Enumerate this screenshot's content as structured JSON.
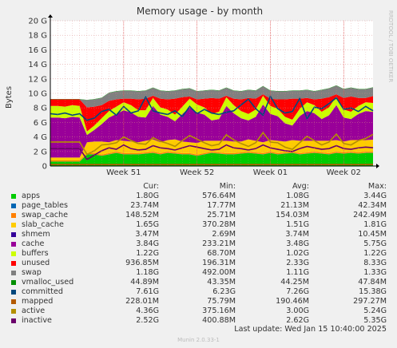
{
  "chart_data": {
    "type": "area",
    "title": "Memory usage - by month",
    "ylabel": "Bytes",
    "watermark": "RRDTOOL / TOBI OETIKER",
    "ylim": [
      0,
      20
    ],
    "yticks": [
      0,
      2,
      4,
      6,
      8,
      10,
      12,
      14,
      16,
      18,
      20
    ],
    "ytick_labels": [
      "0",
      "2 G",
      "4 G",
      "6 G",
      "8 G",
      "10 G",
      "12 G",
      "14 G",
      "16 G",
      "18 G",
      "20 G"
    ],
    "ytick_unit": "G",
    "xlim": [
      0,
      44
    ],
    "xticks": [
      {
        "label": "Week 51",
        "x": 10
      },
      {
        "label": "Week 52",
        "x": 20
      },
      {
        "label": "Week 01",
        "x": 30
      },
      {
        "label": "Week 02",
        "x": 40
      }
    ],
    "x_unit": "days",
    "stacked": true,
    "series": [
      {
        "name": "apps",
        "color": "#00cc00",
        "values": [
          0.6,
          0.6,
          0.6,
          0.6,
          0.6,
          1.6,
          1.6,
          1.4,
          1.6,
          1.8,
          1.6,
          1.6,
          1.6,
          1.7,
          1.8,
          1.6,
          1.8,
          1.7,
          1.6,
          1.6,
          1.4,
          1.6,
          1.8,
          1.7,
          1.6,
          1.6,
          1.7,
          1.8,
          1.7,
          1.6,
          1.8,
          1.6,
          1.7,
          1.8,
          1.6,
          1.7,
          1.8,
          1.7,
          1.6,
          1.8,
          1.7,
          1.8,
          1.7,
          1.8,
          1.8
        ]
      },
      {
        "name": "page_tables",
        "color": "#0066b3",
        "values": [
          0.02,
          0.02,
          0.02,
          0.02,
          0.02,
          0.02,
          0.02,
          0.02,
          0.02,
          0.02,
          0.02,
          0.02,
          0.02,
          0.02,
          0.02,
          0.02,
          0.02,
          0.02,
          0.02,
          0.02,
          0.02,
          0.02,
          0.02,
          0.02,
          0.02,
          0.02,
          0.02,
          0.02,
          0.02,
          0.02,
          0.02,
          0.02,
          0.02,
          0.02,
          0.02,
          0.02,
          0.02,
          0.02,
          0.02,
          0.02,
          0.02,
          0.02,
          0.02,
          0.02,
          0.02
        ]
      },
      {
        "name": "swap_cache",
        "color": "#ff8000",
        "values": [
          0.15,
          0.15,
          0.15,
          0.15,
          0.15,
          0.15,
          0.15,
          0.15,
          0.15,
          0.15,
          0.15,
          0.15,
          0.15,
          0.15,
          0.15,
          0.15,
          0.15,
          0.15,
          0.15,
          0.15,
          0.15,
          0.15,
          0.15,
          0.15,
          0.15,
          0.15,
          0.15,
          0.15,
          0.15,
          0.15,
          0.15,
          0.15,
          0.15,
          0.15,
          0.15,
          0.15,
          0.15,
          0.15,
          0.15,
          0.15,
          0.15,
          0.15,
          0.15,
          0.15,
          0.15
        ]
      },
      {
        "name": "slab_cache",
        "color": "#ffcc00",
        "values": [
          0.4,
          0.4,
          0.4,
          0.4,
          0.4,
          1.5,
          1.6,
          1.8,
          1.5,
          1.6,
          1.7,
          1.6,
          1.5,
          1.6,
          1.7,
          1.5,
          1.6,
          1.8,
          1.6,
          1.5,
          1.6,
          1.7,
          1.5,
          1.6,
          1.7,
          1.6,
          1.5,
          1.7,
          1.6,
          1.5,
          1.6,
          1.7,
          1.5,
          1.6,
          1.7,
          1.6,
          1.5,
          1.6,
          1.7,
          1.6,
          1.5,
          1.6,
          1.7,
          1.6,
          1.65
        ]
      },
      {
        "name": "shmem",
        "color": "#330099",
        "values": [
          0.003,
          0.003,
          0.003,
          0.003,
          0.003,
          0.003,
          0.003,
          0.003,
          0.003,
          0.003,
          0.003,
          0.003,
          0.003,
          0.003,
          0.003,
          0.003,
          0.003,
          0.003,
          0.003,
          0.003,
          0.003,
          0.003,
          0.003,
          0.003,
          0.003,
          0.003,
          0.003,
          0.003,
          0.003,
          0.003,
          0.003,
          0.003,
          0.003,
          0.003,
          0.003,
          0.003,
          0.003,
          0.003,
          0.003,
          0.003,
          0.003,
          0.003,
          0.003,
          0.003,
          0.003
        ]
      },
      {
        "name": "cache",
        "color": "#990099",
        "values": [
          5.5,
          5.5,
          5.4,
          5.6,
          5.5,
          1.0,
          1.6,
          2.4,
          3.4,
          3.6,
          4.2,
          4.0,
          3.5,
          3.2,
          4.6,
          3.8,
          3.2,
          2.5,
          3.8,
          4.8,
          4.2,
          3.6,
          2.8,
          3.0,
          4.8,
          3.9,
          3.2,
          2.6,
          3.3,
          5.2,
          3.6,
          3.4,
          2.5,
          2.0,
          3.4,
          4.1,
          3.8,
          3.0,
          3.5,
          4.8,
          3.3,
          2.9,
          3.6,
          4.0,
          3.84
        ]
      },
      {
        "name": "buffers",
        "color": "#ccff00",
        "values": [
          1.6,
          1.6,
          1.6,
          1.6,
          1.6,
          0.5,
          0.6,
          0.8,
          0.9,
          1.0,
          1.1,
          1.0,
          0.9,
          1.0,
          1.1,
          1.0,
          1.0,
          0.9,
          1.0,
          1.2,
          1.1,
          1.0,
          0.9,
          1.0,
          1.2,
          1.1,
          1.0,
          0.9,
          1.0,
          1.2,
          1.1,
          1.0,
          0.9,
          0.8,
          1.0,
          1.2,
          1.1,
          1.0,
          1.1,
          1.2,
          1.1,
          1.0,
          1.1,
          1.2,
          1.22
        ]
      },
      {
        "name": "unused",
        "color": "#ff0000",
        "values": [
          0.9,
          0.9,
          1.0,
          0.8,
          0.9,
          3.3,
          2.6,
          1.8,
          1.4,
          1.0,
          0.5,
          0.9,
          1.5,
          1.6,
          0.3,
          1.2,
          1.4,
          2.2,
          1.3,
          0.3,
          0.7,
          1.2,
          2.2,
          1.8,
          0.2,
          0.9,
          1.6,
          2.2,
          1.5,
          0.2,
          1.0,
          1.3,
          2.4,
          2.9,
          1.4,
          0.6,
          0.8,
          1.8,
          1.4,
          0.3,
          1.6,
          2.1,
          1.1,
          0.6,
          0.94
        ]
      },
      {
        "name": "swap",
        "color": "#808080",
        "values": [
          0.0,
          0.0,
          0.0,
          0.0,
          0.0,
          1.0,
          1.0,
          1.0,
          1.1,
          1.1,
          1.1,
          1.1,
          1.1,
          1.1,
          1.1,
          1.1,
          1.1,
          1.1,
          1.1,
          1.1,
          1.1,
          1.1,
          1.1,
          1.1,
          1.1,
          1.1,
          1.1,
          1.1,
          1.1,
          1.1,
          1.1,
          1.1,
          1.1,
          1.1,
          1.1,
          1.1,
          1.1,
          1.2,
          1.2,
          1.2,
          1.2,
          1.2,
          1.2,
          1.2,
          1.18
        ]
      },
      {
        "name": "vmalloc_used",
        "color": "#008f00",
        "values": [
          0.04,
          0.04,
          0.04,
          0.04,
          0.04,
          0.04,
          0.04,
          0.04,
          0.04,
          0.04,
          0.04,
          0.04,
          0.04,
          0.04,
          0.04,
          0.04,
          0.04,
          0.04,
          0.04,
          0.04,
          0.04,
          0.04,
          0.04,
          0.04,
          0.04,
          0.04,
          0.04,
          0.04,
          0.04,
          0.04,
          0.04,
          0.04,
          0.04,
          0.04,
          0.04,
          0.04,
          0.04,
          0.04,
          0.04,
          0.04,
          0.04,
          0.04,
          0.04,
          0.04,
          0.04
        ]
      }
    ],
    "lines": [
      {
        "name": "committed",
        "color": "#00487d",
        "values": [
          7.2,
          7.1,
          7.3,
          7.0,
          7.2,
          6.3,
          6.6,
          7.5,
          7.8,
          7.0,
          8.2,
          7.3,
          7.6,
          9.5,
          7.6,
          7.3,
          7.1,
          7.6,
          6.8,
          8.2,
          7.2,
          7.8,
          7.3,
          7.1,
          7.4,
          7.6,
          8.4,
          9.2,
          7.9,
          7.0,
          9.6,
          7.9,
          7.3,
          7.5,
          9.3,
          6.5,
          8.1,
          7.9,
          8.6,
          9.4,
          7.8,
          8.0,
          7.5,
          8.2,
          7.61
        ]
      },
      {
        "name": "mapped",
        "color": "#b35a00",
        "values": [
          0.2,
          0.2,
          0.2,
          0.2,
          0.2,
          0.2,
          0.2,
          0.2,
          0.2,
          0.2,
          0.2,
          0.2,
          0.2,
          0.2,
          0.2,
          0.2,
          0.2,
          0.2,
          0.2,
          0.2,
          0.2,
          0.2,
          0.2,
          0.2,
          0.2,
          0.2,
          0.2,
          0.2,
          0.2,
          0.2,
          0.2,
          0.2,
          0.2,
          0.2,
          0.2,
          0.2,
          0.2,
          0.2,
          0.2,
          0.2,
          0.2,
          0.2,
          0.2,
          0.2,
          0.23
        ]
      },
      {
        "name": "active",
        "color": "#b38f00",
        "values": [
          3.3,
          3.3,
          3.3,
          3.3,
          3.3,
          1.6,
          2.1,
          2.9,
          3.0,
          3.2,
          4.0,
          3.5,
          3.1,
          3.0,
          3.9,
          3.4,
          3.1,
          2.7,
          3.5,
          4.2,
          3.7,
          3.2,
          2.8,
          3.0,
          4.3,
          3.6,
          3.1,
          2.7,
          3.2,
          4.6,
          3.3,
          3.2,
          2.6,
          2.3,
          3.2,
          4.1,
          3.5,
          2.9,
          3.3,
          4.4,
          3.1,
          2.9,
          3.5,
          3.8,
          4.36
        ]
      },
      {
        "name": "inactive",
        "color": "#6b006b",
        "values": [
          2.4,
          2.4,
          2.4,
          2.4,
          2.4,
          0.9,
          1.5,
          2.1,
          2.5,
          2.3,
          2.9,
          2.4,
          2.2,
          2.3,
          2.8,
          2.5,
          2.4,
          2.2,
          2.5,
          2.8,
          2.6,
          2.4,
          2.2,
          2.3,
          2.9,
          2.5,
          2.4,
          2.2,
          2.4,
          2.9,
          2.5,
          2.3,
          2.1,
          2.0,
          2.4,
          2.7,
          2.5,
          2.3,
          2.4,
          2.8,
          2.4,
          2.3,
          2.5,
          2.6,
          2.52
        ]
      }
    ],
    "grid": true
  },
  "legend": {
    "headers": {
      "cur": "Cur:",
      "min": "Min:",
      "avg": "Avg:",
      "max": "Max:"
    },
    "rows": [
      {
        "name": "apps",
        "color": "#00cc00",
        "cur": "1.80G",
        "min": "576.64M",
        "avg": "1.08G",
        "max": "3.44G"
      },
      {
        "name": "page_tables",
        "color": "#0066b3",
        "cur": "23.74M",
        "min": "17.77M",
        "avg": "21.13M",
        "max": "42.34M"
      },
      {
        "name": "swap_cache",
        "color": "#ff8000",
        "cur": "148.52M",
        "min": "25.71M",
        "avg": "154.03M",
        "max": "242.49M"
      },
      {
        "name": "slab_cache",
        "color": "#ffcc00",
        "cur": "1.65G",
        "min": "370.28M",
        "avg": "1.51G",
        "max": "1.81G"
      },
      {
        "name": "shmem",
        "color": "#330099",
        "cur": "3.47M",
        "min": "2.69M",
        "avg": "3.74M",
        "max": "10.45M"
      },
      {
        "name": "cache",
        "color": "#990099",
        "cur": "3.84G",
        "min": "233.21M",
        "avg": "3.48G",
        "max": "5.75G"
      },
      {
        "name": "buffers",
        "color": "#ccff00",
        "cur": "1.22G",
        "min": "68.70M",
        "avg": "1.02G",
        "max": "1.22G"
      },
      {
        "name": "unused",
        "color": "#ff0000",
        "cur": "936.85M",
        "min": "196.31M",
        "avg": "2.33G",
        "max": "8.33G"
      },
      {
        "name": "swap",
        "color": "#808080",
        "cur": "1.18G",
        "min": "492.00M",
        "avg": "1.11G",
        "max": "1.33G"
      },
      {
        "name": "vmalloc_used",
        "color": "#008f00",
        "cur": "44.89M",
        "min": "43.35M",
        "avg": "44.25M",
        "max": "47.84M"
      },
      {
        "name": "committed",
        "color": "#00487d",
        "cur": "7.61G",
        "min": "6.23G",
        "avg": "7.26G",
        "max": "15.38G"
      },
      {
        "name": "mapped",
        "color": "#b35a00",
        "cur": "228.01M",
        "min": "75.79M",
        "avg": "190.46M",
        "max": "297.27M"
      },
      {
        "name": "active",
        "color": "#b38f00",
        "cur": "4.36G",
        "min": "375.16M",
        "avg": "3.00G",
        "max": "5.24G"
      },
      {
        "name": "inactive",
        "color": "#6b006b",
        "cur": "2.52G",
        "min": "400.88M",
        "avg": "2.62G",
        "max": "5.35G"
      }
    ]
  },
  "last_update": "Last update:  Wed Jan 15 10:40:00 2025",
  "footer": "Munin 2.0.33-1"
}
